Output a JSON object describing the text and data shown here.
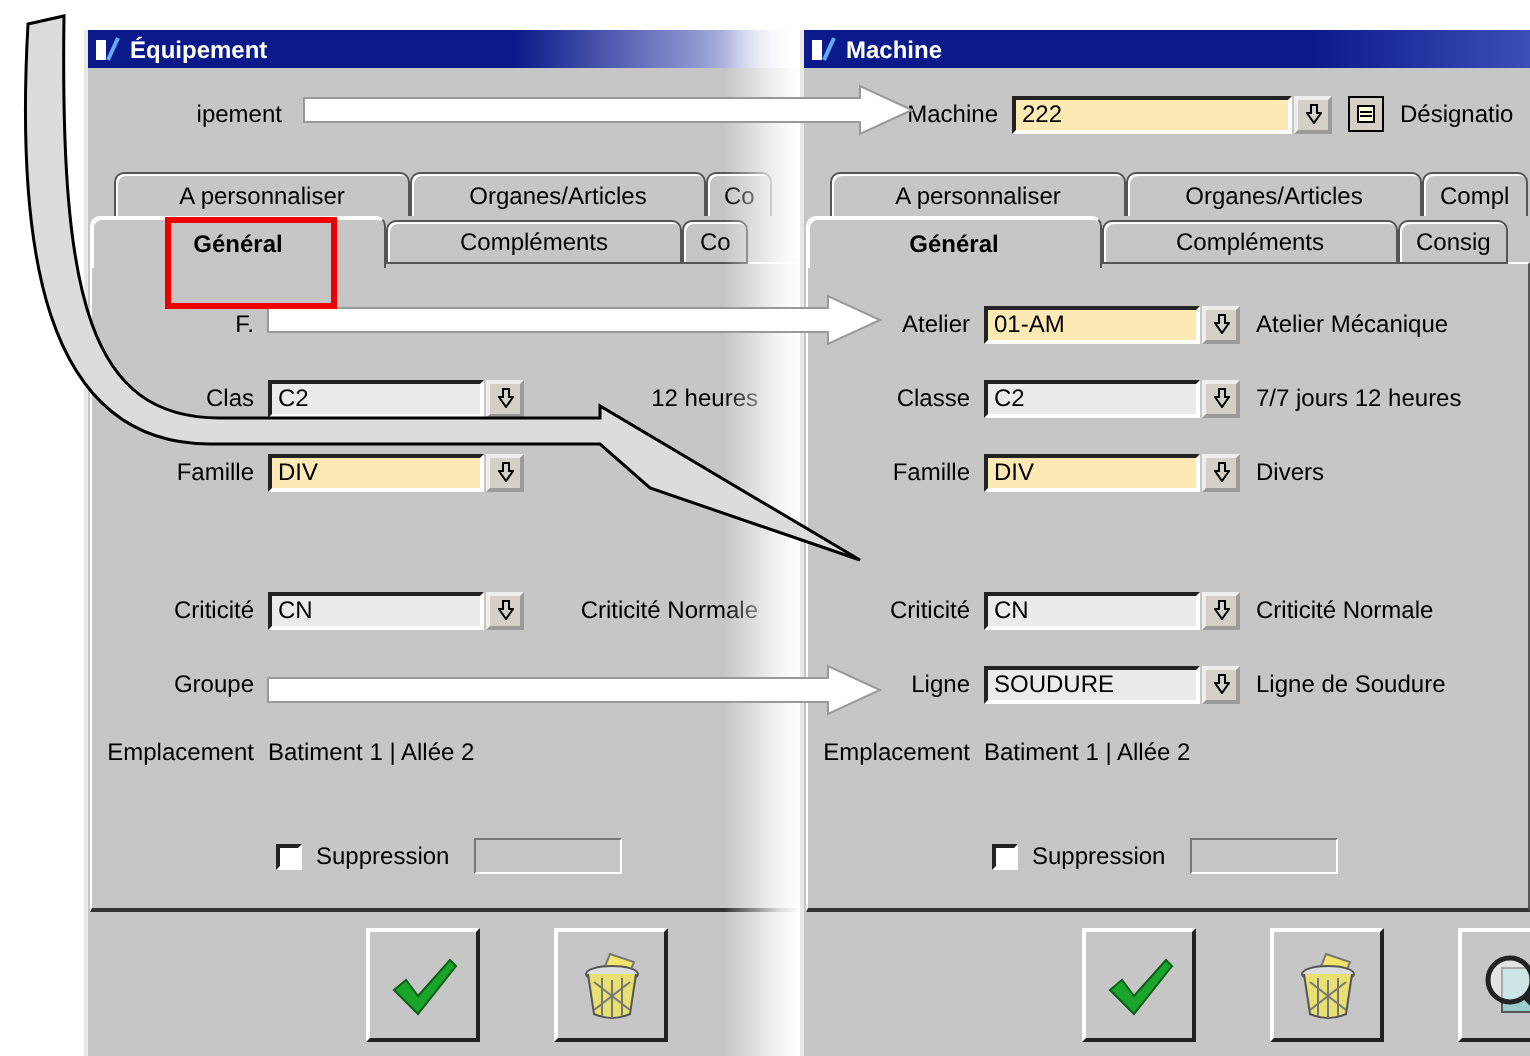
{
  "windows": [
    {
      "title": "Équipement",
      "faded": true,
      "header_field": {
        "label": "ipement",
        "input": false
      },
      "tabs_back": [
        {
          "label": "A personnaliser",
          "selected": false
        },
        {
          "label": "Organes/Articles",
          "selected": false
        },
        {
          "label": "Co",
          "selected": false
        }
      ],
      "tabs_front": [
        {
          "label": "Général",
          "selected": true
        },
        {
          "label": "Compléments",
          "selected": false
        },
        {
          "label": "Co",
          "selected": false
        }
      ],
      "field_groups": [
        [
          {
            "label": "F.",
            "input": false
          },
          {
            "label": "Clas",
            "input": true,
            "value": "C2",
            "required": false,
            "description": "12 heures"
          },
          {
            "label": "Famille",
            "input": true,
            "value": "DIV",
            "required": true
          }
        ],
        [
          {
            "label": "Criticité",
            "input": true,
            "value": "CN",
            "required": false,
            "description": "Criticité Normale"
          },
          {
            "label": "Groupe",
            "input": false
          }
        ]
      ],
      "location": {
        "label": "Emplacement",
        "value": "Batiment 1 | Allée 2"
      },
      "suppression": {
        "label": "Suppression",
        "checked": false
      },
      "buttons": [
        {
          "kind": "validate"
        },
        {
          "kind": "delete"
        }
      ]
    },
    {
      "title": "Machine",
      "faded": false,
      "header_field": {
        "label": "Machine",
        "input": true,
        "value": "222",
        "required": true,
        "description": "Désignatio"
      },
      "tabs_back": [
        {
          "label": "A personnaliser",
          "selected": false
        },
        {
          "label": "Organes/Articles",
          "selected": false
        },
        {
          "label": "Compl",
          "selected": false
        }
      ],
      "tabs_front": [
        {
          "label": "Général",
          "selected": true
        },
        {
          "label": "Compléments",
          "selected": false
        },
        {
          "label": "Consig",
          "selected": false
        }
      ],
      "field_groups": [
        [
          {
            "label": "Atelier",
            "input": true,
            "value": "01-AM",
            "required": true,
            "description": "Atelier Mécanique"
          },
          {
            "label": "Classe",
            "input": true,
            "value": "C2",
            "required": false,
            "description": "7/7 jours 12 heures"
          },
          {
            "label": "Famille",
            "input": true,
            "value": "DIV",
            "required": true,
            "description": "Divers"
          }
        ],
        [
          {
            "label": "Criticité",
            "input": true,
            "value": "CN",
            "required": false,
            "description": "Criticité Normale"
          },
          {
            "label": "Ligne",
            "input": true,
            "value": "SOUDURE",
            "required": false,
            "description": "Ligne de Soudure"
          }
        ]
      ],
      "location": {
        "label": "Emplacement",
        "value": "Batiment 1 | Allée 2"
      },
      "suppression": {
        "label": "Suppression",
        "checked": false
      },
      "buttons": [
        {
          "kind": "validate"
        },
        {
          "kind": "delete"
        },
        {
          "kind": "search"
        }
      ]
    }
  ]
}
